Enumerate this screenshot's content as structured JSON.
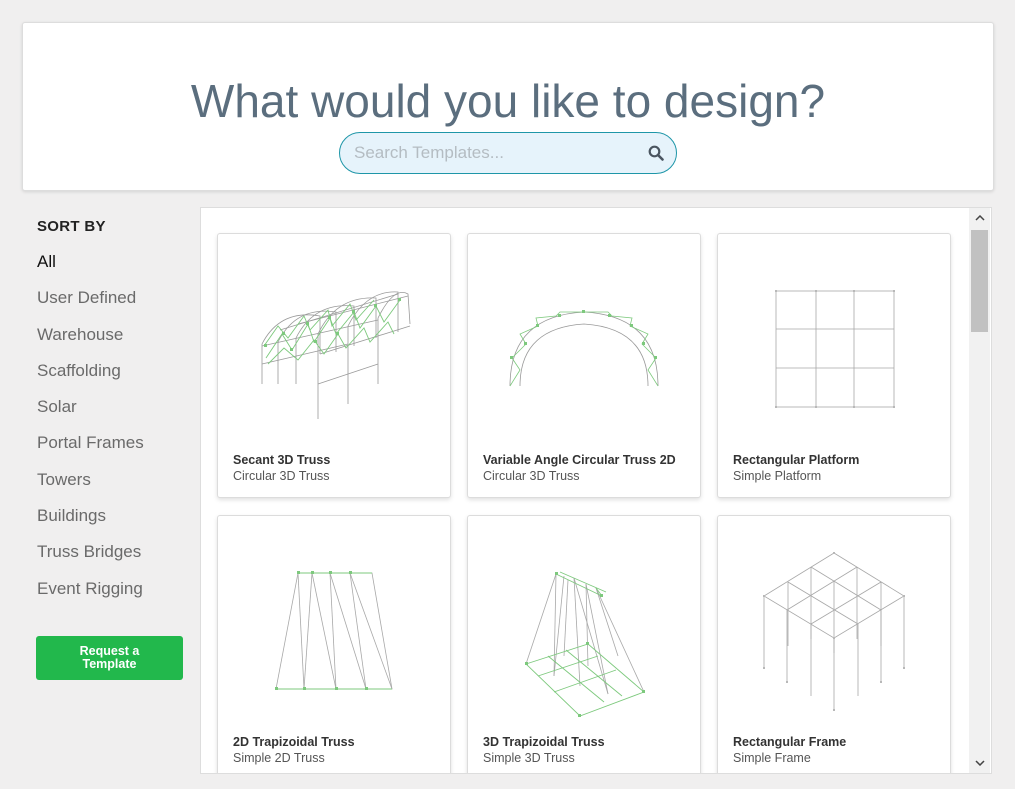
{
  "header": {
    "title": "What would you like to design?",
    "search_placeholder": "Search Templates..."
  },
  "sidebar": {
    "heading": "SORT BY",
    "items": [
      {
        "label": "All",
        "active": true
      },
      {
        "label": "User Defined"
      },
      {
        "label": "Warehouse"
      },
      {
        "label": "Scaffolding"
      },
      {
        "label": "Solar"
      },
      {
        "label": "Portal Frames"
      },
      {
        "label": "Towers"
      },
      {
        "label": "Buildings"
      },
      {
        "label": "Truss Bridges"
      },
      {
        "label": "Event Rigging"
      }
    ],
    "request_button": "Request a Template"
  },
  "templates": [
    {
      "title": "Secant 3D Truss",
      "subtitle": "Circular 3D Truss"
    },
    {
      "title": "Variable Angle Circular Truss 2D",
      "subtitle": "Circular 3D Truss"
    },
    {
      "title": "Rectangular Platform",
      "subtitle": "Simple Platform"
    },
    {
      "title": "2D Trapizoidal Truss",
      "subtitle": "Simple 2D Truss"
    },
    {
      "title": "3D Trapizoidal Truss",
      "subtitle": "Simple 3D Truss"
    },
    {
      "title": "Rectangular Frame",
      "subtitle": "Simple Frame"
    }
  ],
  "colors": {
    "accent_green": "#22b84c",
    "search_border": "#1e96a8",
    "title_color": "#5b6e7e"
  }
}
